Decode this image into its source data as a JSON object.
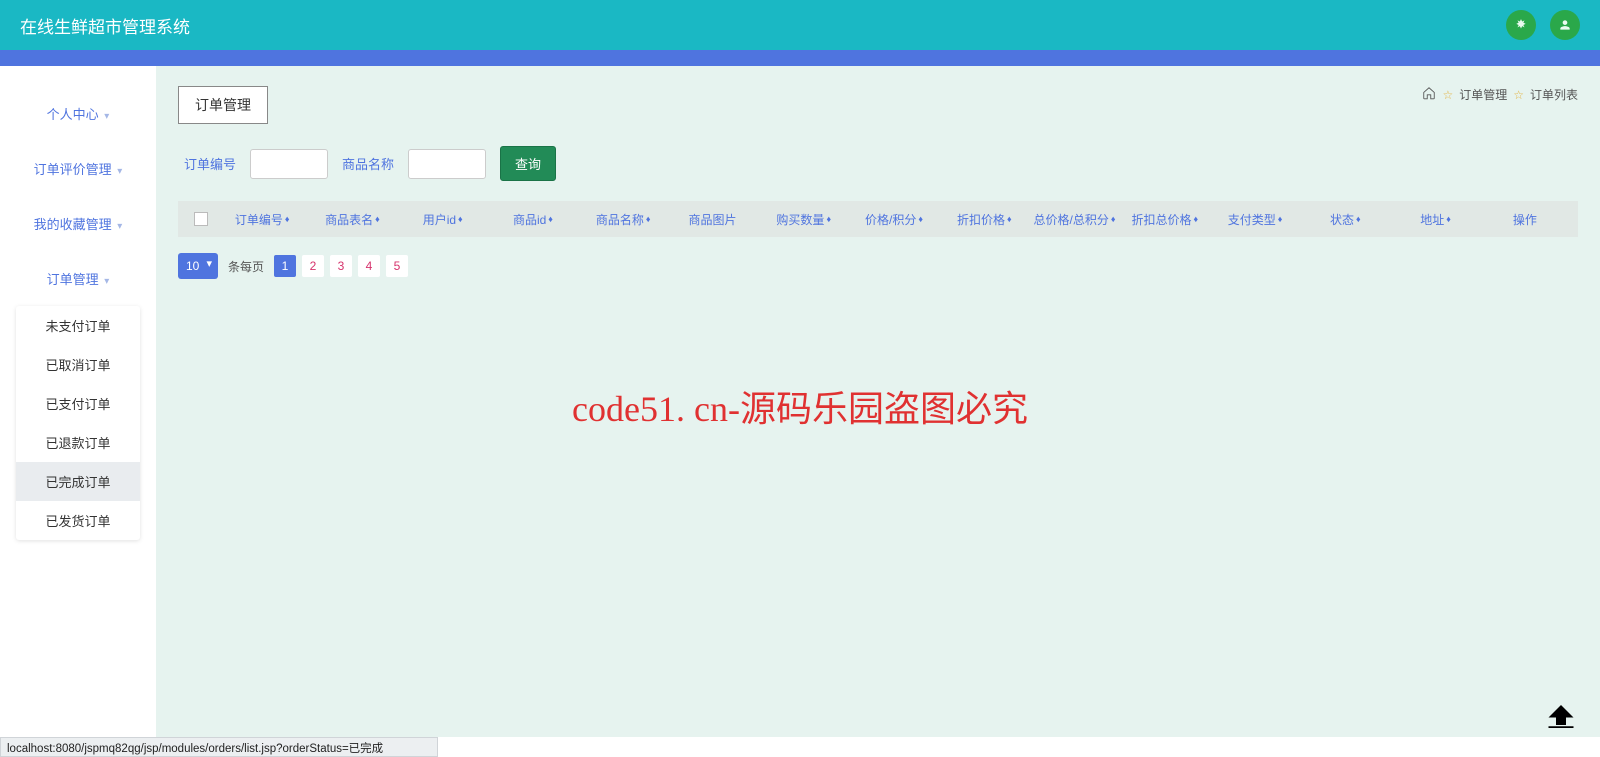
{
  "header": {
    "title": "在线生鲜超市管理系统"
  },
  "sidebar": {
    "items": [
      {
        "label": "个人中心"
      },
      {
        "label": "订单评价管理"
      },
      {
        "label": "我的收藏管理"
      },
      {
        "label": "订单管理"
      }
    ],
    "submenu": {
      "items": [
        {
          "label": "未支付订单"
        },
        {
          "label": "已取消订单"
        },
        {
          "label": "已支付订单"
        },
        {
          "label": "已退款订单"
        },
        {
          "label": "已完成订单",
          "active": true
        },
        {
          "label": "已发货订单"
        }
      ]
    }
  },
  "panel": {
    "button": "订单管理"
  },
  "breadcrumb": {
    "mgmt": "订单管理",
    "list": "订单列表"
  },
  "search": {
    "orderNoLabel": "订单编号",
    "orderNoValue": "",
    "productNameLabel": "商品名称",
    "productNameValue": "",
    "submit": "查询"
  },
  "table": {
    "columns": [
      "订单编号",
      "商品表名",
      "用户id",
      "商品id",
      "商品名称",
      "商品图片",
      "购买数量",
      "价格/积分",
      "折扣价格",
      "总价格/总积分",
      "折扣总价格",
      "支付类型",
      "状态",
      "地址",
      "操作"
    ]
  },
  "pagination": {
    "pageSize": "10",
    "perLabel": "条每页",
    "pages": [
      "1",
      "2",
      "3",
      "4",
      "5"
    ],
    "active": "1"
  },
  "watermark": "code51. cn-源码乐园盗图必究",
  "statusbar": "localhost:8080/jspmq82qg/jsp/modules/orders/list.jsp?orderStatus=已完成"
}
